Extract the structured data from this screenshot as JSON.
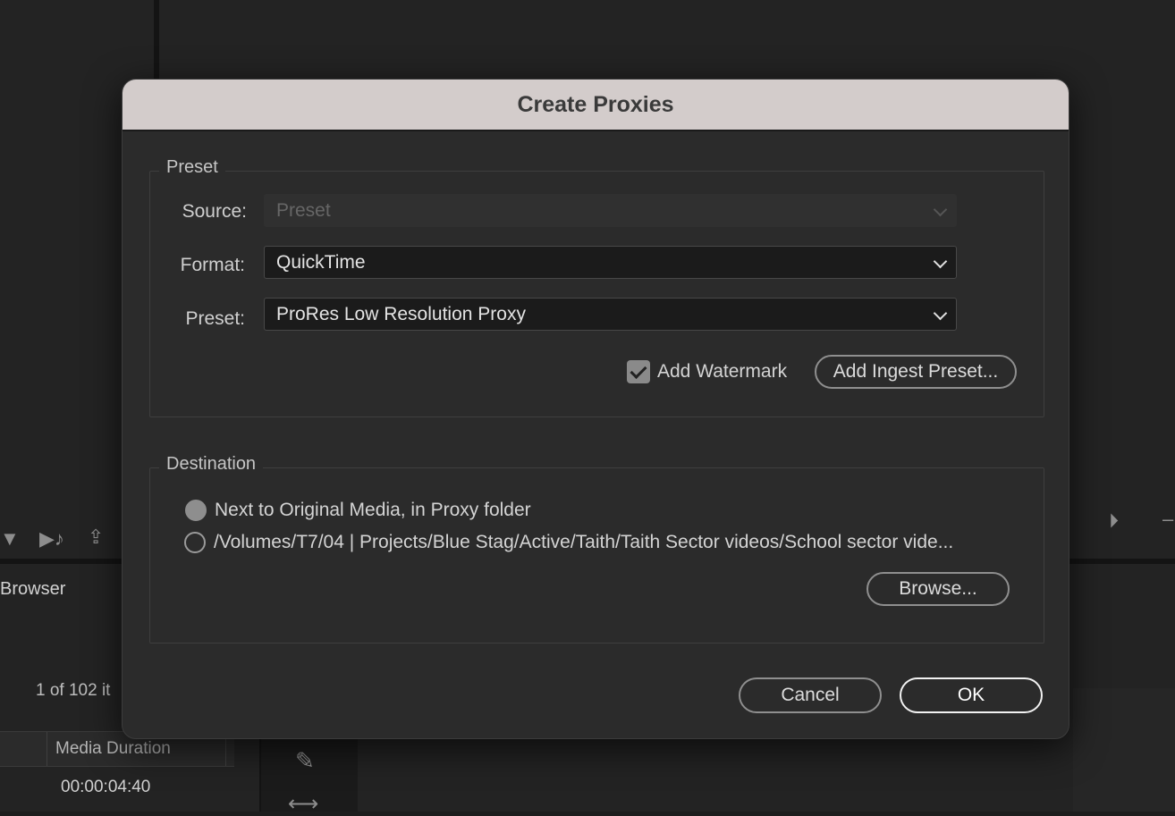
{
  "background": {
    "browser_label": "Browser",
    "item_count": "1 of 102 it",
    "column_header": "Media Duration",
    "duration_cell": "00:00:04:40",
    "icons": [
      "filter-icon",
      "audio-icon",
      "export-icon",
      "play-icon",
      "razor-icon",
      "stretch-icon"
    ]
  },
  "dialog": {
    "title": "Create Proxies",
    "preset_group": {
      "legend": "Preset",
      "source_label": "Source:",
      "source_value": "Preset",
      "format_label": "Format:",
      "format_value": "QuickTime",
      "preset_label": "Preset:",
      "preset_value": "ProRes Low Resolution Proxy",
      "watermark_label": "Add Watermark",
      "watermark_checked": true,
      "add_ingest_label": "Add Ingest Preset..."
    },
    "destination_group": {
      "legend": "Destination",
      "option_original": "Next to Original Media, in Proxy folder",
      "option_path": "/Volumes/T7/04 | Projects/Blue Stag/Active/Taith/Taith Sector videos/School sector vide...",
      "selected": "original",
      "browse_label": "Browse..."
    },
    "cancel_label": "Cancel",
    "ok_label": "OK"
  },
  "colors": {
    "titlebar": "#d3cccb",
    "dialog_bg": "#2b2b2b",
    "app_bg": "#232323"
  }
}
